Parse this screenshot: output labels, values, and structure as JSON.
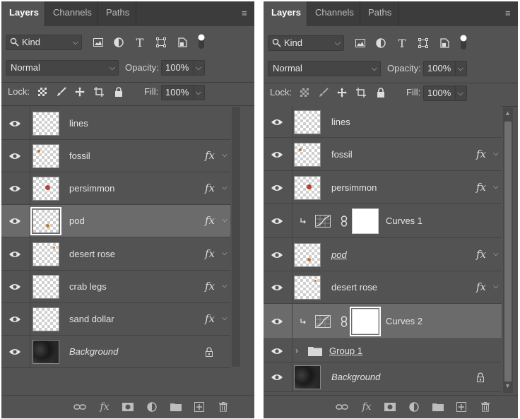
{
  "panels": [
    {
      "id": "left",
      "tabs": [
        "Layers",
        "Channels",
        "Paths"
      ],
      "filter": {
        "kind_label": "Kind"
      },
      "blend": {
        "mode": "Normal",
        "opacity_label": "Opacity:",
        "opacity_value": "100%"
      },
      "lock": {
        "label": "Lock:",
        "fill_label": "Fill:",
        "fill_value": "100%"
      },
      "layers": [
        {
          "name": "lines",
          "fx": false
        },
        {
          "name": "fossil",
          "fx": true
        },
        {
          "name": "persimmon",
          "fx": true
        },
        {
          "name": "pod",
          "fx": true,
          "selected": true
        },
        {
          "name": "desert rose",
          "fx": true
        },
        {
          "name": "crab legs",
          "fx": true
        },
        {
          "name": "sand dollar",
          "fx": true
        },
        {
          "name": "Background",
          "fx": false,
          "locked": true,
          "italic": true
        }
      ],
      "fx_label": "fx"
    },
    {
      "id": "right",
      "tabs": [
        "Layers",
        "Channels",
        "Paths"
      ],
      "filter": {
        "kind_label": "Kind"
      },
      "blend": {
        "mode": "Normal",
        "opacity_label": "Opacity:",
        "opacity_value": "100%"
      },
      "lock": {
        "label": "Lock:",
        "fill_label": "Fill:",
        "fill_value": "100%"
      },
      "layers": [
        {
          "name": "lines",
          "fx": false
        },
        {
          "name": "fossil",
          "fx": true
        },
        {
          "name": "persimmon",
          "fx": true
        },
        {
          "name": "Curves 1",
          "type": "adjustment"
        },
        {
          "name": "pod",
          "fx": true,
          "underline": true,
          "italic": true
        },
        {
          "name": "desert rose",
          "fx": true
        },
        {
          "name": "Curves 2",
          "type": "adjustment",
          "selected": true
        },
        {
          "name": "Group 1",
          "type": "group",
          "underline": true
        },
        {
          "name": "Background",
          "fx": false,
          "locked": true,
          "italic": true
        }
      ],
      "fx_label": "fx"
    }
  ],
  "colors": {
    "panel_bg": "#535353",
    "tabbar_bg": "#3c3c3c",
    "selected_row": "#6b6b6b",
    "text": "#e4e4e4"
  }
}
